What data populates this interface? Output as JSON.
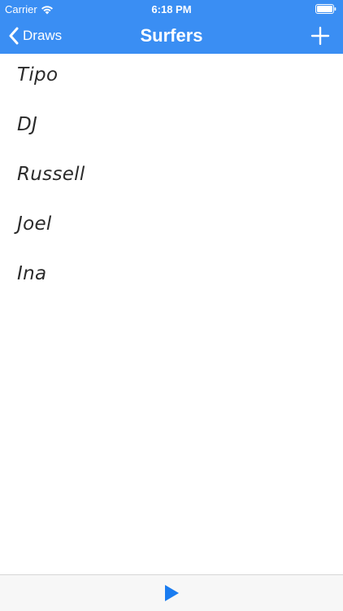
{
  "status_bar": {
    "carrier": "Carrier",
    "time": "6:18 PM",
    "wifi_icon": "wifi-icon",
    "battery_icon": "battery-icon"
  },
  "nav": {
    "back_label": "Draws",
    "back_icon": "chevron-left-icon",
    "title": "Surfers",
    "add_icon": "plus-icon"
  },
  "surfers": [
    {
      "name": "Tipo"
    },
    {
      "name": "DJ"
    },
    {
      "name": "Russell"
    },
    {
      "name": "Joel"
    },
    {
      "name": "Ina"
    }
  ],
  "toolbar": {
    "play_icon": "play-icon"
  },
  "colors": {
    "header": "#3a8ef3",
    "header_text": "#ffffff",
    "toolbar_bg": "#f7f7f7",
    "accent": "#1a7cf0",
    "item_text": "#2b2b2b"
  }
}
